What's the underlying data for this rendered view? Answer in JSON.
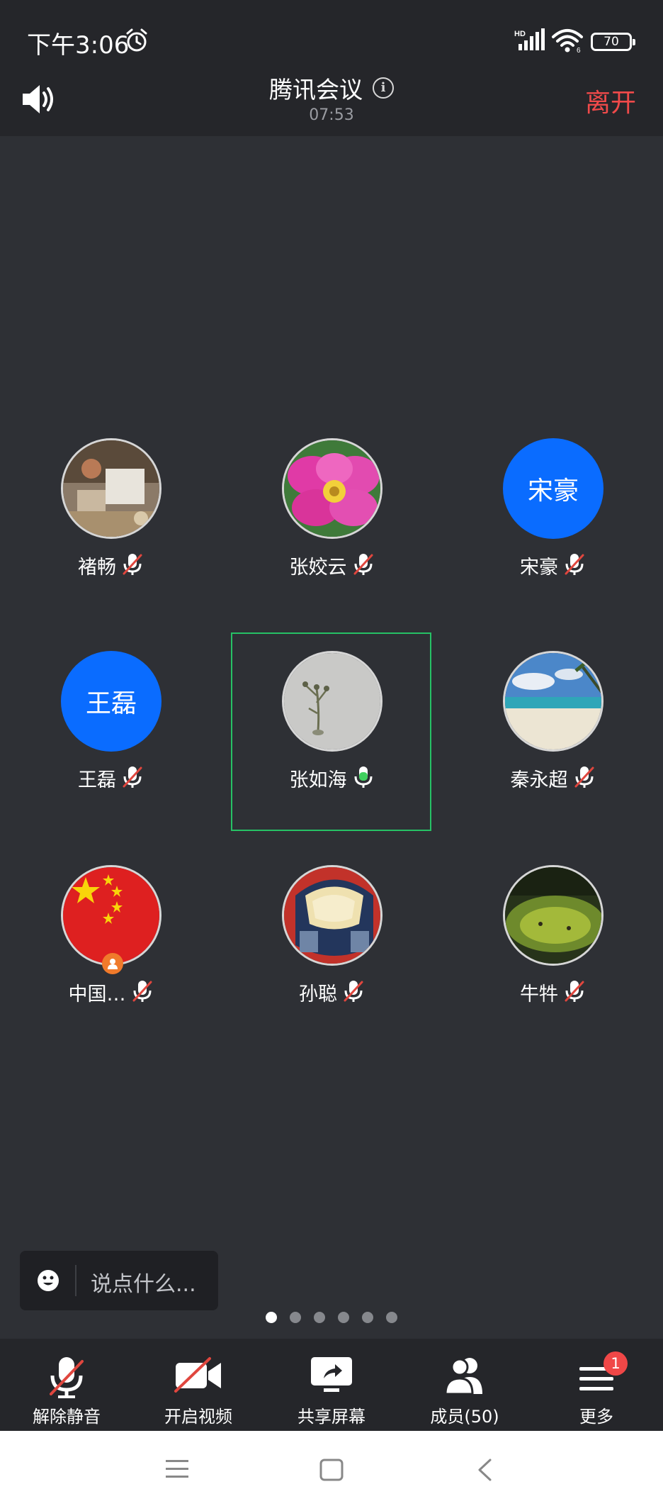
{
  "status_bar": {
    "time": "下午3:06",
    "battery_level": "70",
    "icons": [
      "alarm-icon",
      "signal-hd-icon",
      "wifi-icon",
      "battery-icon"
    ]
  },
  "header": {
    "title": "腾讯会议",
    "duration": "07:53",
    "leave_label": "离开"
  },
  "participants": [
    {
      "name": "褚畅",
      "avatar": "photo-room",
      "mic": "muted"
    },
    {
      "name": "张姣云",
      "avatar": "photo-pink-flower",
      "mic": "muted"
    },
    {
      "name": "宋豪",
      "avatar_text": "宋豪",
      "mic": "muted"
    },
    {
      "name": "王磊",
      "avatar_text": "王磊",
      "mic": "muted"
    },
    {
      "name": "张如海",
      "avatar": "photo-plant",
      "mic": "speaking",
      "active": true
    },
    {
      "name": "秦永超",
      "avatar": "photo-beach",
      "mic": "muted"
    },
    {
      "name": "中国…",
      "avatar": "photo-china-flag",
      "mic": "muted",
      "host": true
    },
    {
      "name": "孙聪",
      "avatar": "photo-helmet",
      "mic": "muted"
    },
    {
      "name": "牛牪",
      "avatar": "photo-grassland",
      "mic": "muted"
    }
  ],
  "chat": {
    "placeholder": "说点什么..."
  },
  "pagination": {
    "pages": 6,
    "current": 1
  },
  "toolbar": {
    "unmute_label": "解除静音",
    "video_label": "开启视频",
    "share_label": "共享屏幕",
    "members_label": "成员(50)",
    "more_label": "更多",
    "more_badge": "1"
  },
  "colors": {
    "background": "#2e3035",
    "bar": "#25262a",
    "leave": "#f04a4a",
    "avatar_blue": "#0a6cff",
    "active_border": "#26c165",
    "mic_muted_slash": "#e0463e",
    "mic_active": "#3fd05e"
  }
}
